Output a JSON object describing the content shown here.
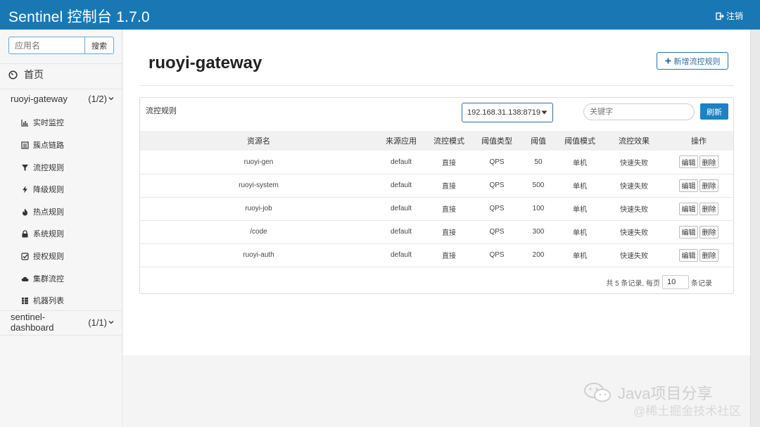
{
  "header": {
    "title": "Sentinel 控制台 1.7.0",
    "logout": "注销"
  },
  "sidebar": {
    "search_placeholder": "应用名",
    "search_button": "搜索",
    "home": "首页",
    "apps": [
      {
        "name": "ruoyi-gateway",
        "count": "(1/2)"
      },
      {
        "name": "sentinel-dashboard",
        "count": "(1/1)"
      }
    ],
    "items": [
      {
        "label": "实时监控",
        "icon": "bar-chart-icon"
      },
      {
        "label": "簇点链路",
        "icon": "list-icon"
      },
      {
        "label": "流控规则",
        "icon": "filter-icon"
      },
      {
        "label": "降级规则",
        "icon": "flash-icon"
      },
      {
        "label": "热点规则",
        "icon": "fire-icon"
      },
      {
        "label": "系统规则",
        "icon": "lock-icon"
      },
      {
        "label": "授权规则",
        "icon": "check-icon"
      },
      {
        "label": "集群流控",
        "icon": "cloud-icon"
      },
      {
        "label": "机器列表",
        "icon": "grid-icon"
      }
    ]
  },
  "main": {
    "title": "ruoyi-gateway",
    "add_button": "新增流控规则",
    "panel_title": "流控规则",
    "machine": "192.168.31.138:8719",
    "keyword_placeholder": "关键字",
    "refresh": "刷新",
    "columns": [
      "资源名",
      "来源应用",
      "流控模式",
      "阈值类型",
      "阈值",
      "阈值模式",
      "流控效果",
      "操作"
    ],
    "rows": [
      [
        "ruoyi-gen",
        "default",
        "直接",
        "QPS",
        "50",
        "单机",
        "快速失败"
      ],
      [
        "ruoyi-system",
        "default",
        "直接",
        "QPS",
        "500",
        "单机",
        "快速失败"
      ],
      [
        "ruoyi-job",
        "default",
        "直接",
        "QPS",
        "100",
        "单机",
        "快速失败"
      ],
      [
        "/code",
        "default",
        "直接",
        "QPS",
        "300",
        "单机",
        "快速失败"
      ],
      [
        "ruoyi-auth",
        "default",
        "直接",
        "QPS",
        "200",
        "单机",
        "快速失败"
      ]
    ],
    "edit_label": "编辑",
    "delete_label": "删除",
    "pager": {
      "prefix": "共 5 条记录, 每页",
      "page_size": "10",
      "suffix": "条记录"
    }
  },
  "watermark": {
    "line1": "Java项目分享",
    "line2": "@稀土掘金技术社区"
  }
}
